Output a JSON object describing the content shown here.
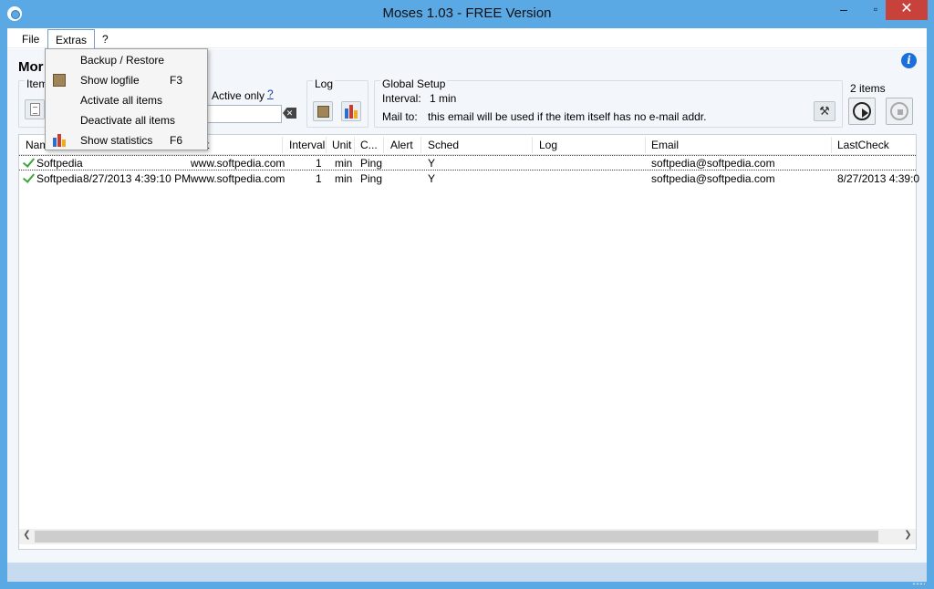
{
  "window": {
    "title": "Moses 1.03  -  FREE Version",
    "min_glyph": "‒",
    "max_glyph": "▫",
    "close_glyph": "✕"
  },
  "menu": {
    "file": "File",
    "extras": "Extras",
    "help": "?"
  },
  "dropdown": {
    "items": [
      {
        "label": "Backup / Restore",
        "shortcut": "",
        "icon": ""
      },
      {
        "label": "Show logfile",
        "shortcut": "F3",
        "icon": "logfile-icon"
      },
      {
        "label": "Activate all items",
        "shortcut": "",
        "icon": ""
      },
      {
        "label": "Deactivate all items",
        "shortcut": "",
        "icon": ""
      },
      {
        "label": "Show statistics",
        "shortcut": "F6",
        "icon": "statistics-icon"
      }
    ]
  },
  "toolbar": {
    "page_title": "Mor",
    "info_glyph": "i",
    "item_group": "Item",
    "active_only": "Active only",
    "active_help": "?",
    "filter_value": "",
    "log_group": "Log",
    "global_group": "Global Setup",
    "interval_label": "Interval:",
    "interval_value": "1 min",
    "mail_label": "Mail to:",
    "mail_value": "this email will be used if the item itself has no e-mail addr.",
    "items_count": "2  items"
  },
  "table": {
    "headers": [
      "Name",
      "t",
      "Interval",
      "Unit",
      "C...",
      "Alert",
      "Sched",
      "Log",
      "Email",
      "LastCheck"
    ],
    "rows": [
      {
        "name": "Softpedia",
        "lastcheck_short": "",
        "target": "www.softpedia.com",
        "interval": "1",
        "unit": "min",
        "check": "Ping",
        "alert": "",
        "sched": "Y",
        "log": "",
        "email": "softpedia@softpedia.com",
        "lastcheck": ""
      },
      {
        "name": "Softpedia",
        "lastcheck_short": "8/27/2013 4:39:10 PM",
        "target": "www.softpedia.com",
        "interval": "1",
        "unit": "min",
        "check": "Ping",
        "alert": "",
        "sched": "Y",
        "log": "",
        "email": "softpedia@softpedia.com",
        "lastcheck": "8/27/2013 4:39:0"
      }
    ]
  },
  "colors": {
    "titlebar": "#5aa8e4",
    "close": "#c7423a",
    "check": "#3ca83c"
  }
}
